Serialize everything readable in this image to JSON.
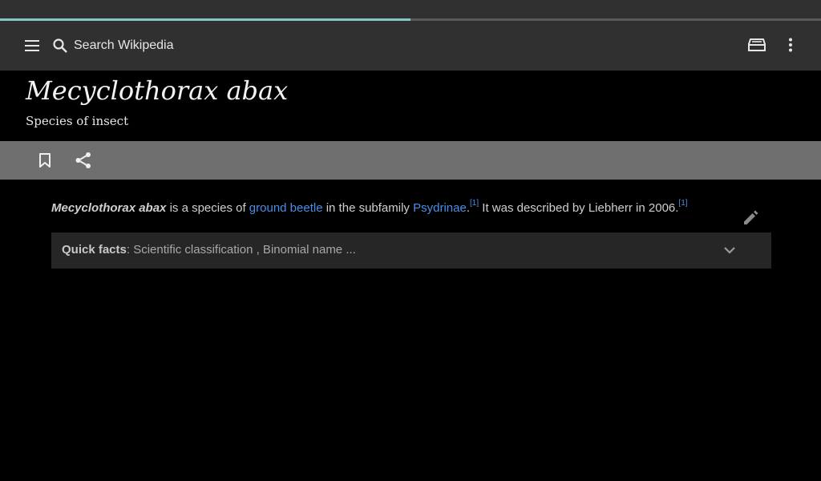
{
  "page": {
    "progress": 0.5
  },
  "toolbar": {
    "menu_icon": "hamburger-menu-icon",
    "search_placeholder": "Search Wikipedia",
    "reading_lists_icon": "reading-lists-icon",
    "overflow_icon": "more-vert-icon"
  },
  "article": {
    "title": "Mecyclothorax abax",
    "description": "Species of insect",
    "bookmark_icon": "bookmark-icon",
    "share_icon": "share-icon",
    "edit_icon": "pencil-edit-icon",
    "lead": {
      "subject": "Mecyclothorax abax",
      "text1": " is a species of ",
      "link1": "ground beetle",
      "text2": " in the subfamily ",
      "link2": "Psydrinae",
      "text3": ".",
      "ref1": "[1]",
      "text4": " It was described by Liebherr in 2006.",
      "ref2": "[1]"
    },
    "quick_facts": {
      "label": "Quick facts",
      "summary": ": Scientific classification , Binomial name ..."
    }
  },
  "colors": {
    "toolbar_bg": "#303030",
    "action_bar_bg": "#6f6f6f",
    "link": "#4a8ee6",
    "progress": "#7fc8c3"
  }
}
